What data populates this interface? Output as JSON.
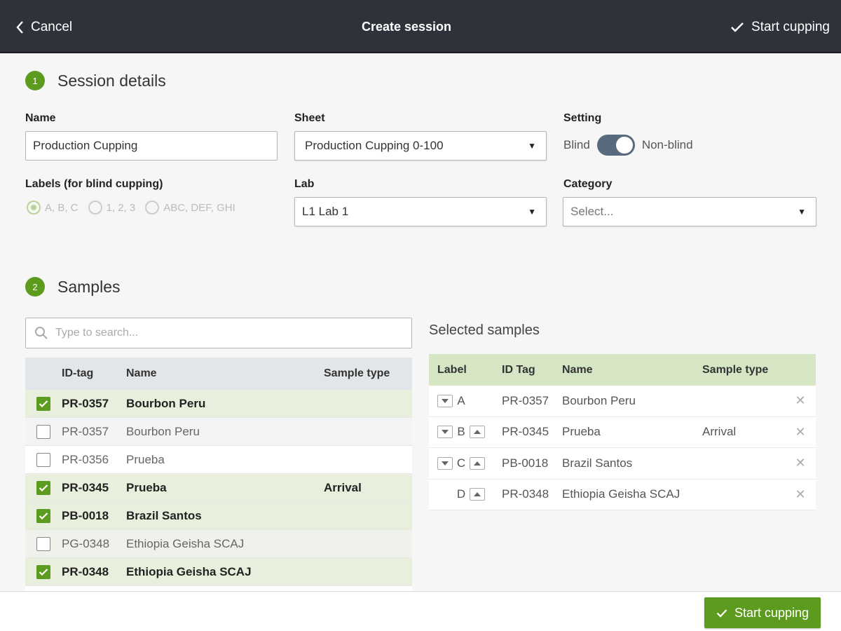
{
  "header": {
    "cancel_label": "Cancel",
    "title": "Create session",
    "start_label": "Start cupping"
  },
  "session_details": {
    "step_number": "1",
    "heading": "Session details",
    "name_label": "Name",
    "name_value": "Production Cupping",
    "sheet_label": "Sheet",
    "sheet_value": "Production Cupping 0-100",
    "setting_label": "Setting",
    "setting_left": "Blind",
    "setting_right": "Non-blind",
    "labels_label": "Labels (for blind cupping)",
    "label_options": [
      "A, B, C",
      "1, 2, 3",
      "ABC, DEF, GHI"
    ],
    "lab_label": "Lab",
    "lab_value": "L1 Lab 1",
    "category_label": "Category",
    "category_placeholder": "Select..."
  },
  "samples": {
    "step_number": "2",
    "heading": "Samples",
    "search_placeholder": "Type to search...",
    "columns": [
      "ID-tag",
      "Name",
      "Sample type"
    ],
    "rows": [
      {
        "id": "PR-0357",
        "name": "Bourbon Peru",
        "type": "",
        "checked": true
      },
      {
        "id": "PR-0357",
        "name": "Bourbon Peru",
        "type": "",
        "checked": false
      },
      {
        "id": "PR-0356",
        "name": "Prueba",
        "type": "",
        "checked": false
      },
      {
        "id": "PR-0345",
        "name": "Prueba",
        "type": "Arrival",
        "checked": true
      },
      {
        "id": "PB-0018",
        "name": "Brazil Santos",
        "type": "",
        "checked": true
      },
      {
        "id": "PG-0348",
        "name": "Ethiopia Geisha SCAJ",
        "type": "",
        "checked": false
      },
      {
        "id": "PR-0348",
        "name": "Ethiopia Geisha SCAJ",
        "type": "",
        "checked": true
      }
    ]
  },
  "selected": {
    "title": "Selected samples",
    "columns": [
      "Label",
      "ID Tag",
      "Name",
      "Sample type"
    ],
    "rows": [
      {
        "label": "A",
        "id": "PR-0357",
        "name": "Bourbon Peru",
        "type": ""
      },
      {
        "label": "B",
        "id": "PR-0345",
        "name": "Prueba",
        "type": "Arrival"
      },
      {
        "label": "C",
        "id": "PB-0018",
        "name": "Brazil Santos",
        "type": ""
      },
      {
        "label": "D",
        "id": "PR-0348",
        "name": "Ethiopia Geisha SCAJ",
        "type": ""
      }
    ]
  },
  "footer": {
    "start_label": "Start cupping"
  },
  "colors": {
    "accent": "#5d9b1f",
    "header_bg": "#2f323a"
  }
}
